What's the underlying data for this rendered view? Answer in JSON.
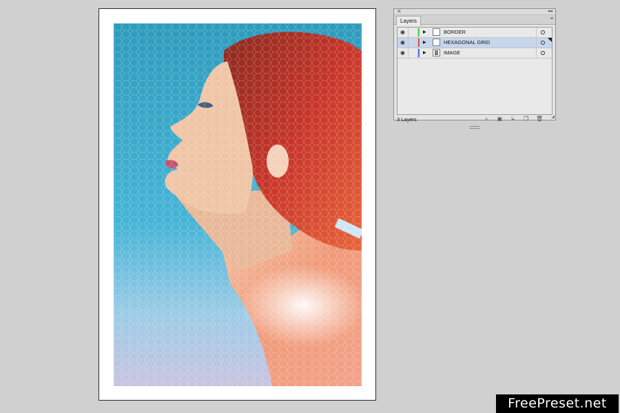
{
  "panel": {
    "close_glyph": "✕",
    "collapse_glyph": "◂◂",
    "tab_label": "Layers",
    "menu_glyph": "≡",
    "layers": [
      {
        "name": "BORDER",
        "color": "#4cd44c",
        "visible": true,
        "selected": false
      },
      {
        "name": "HEXAGONAL GRID",
        "color": "#e84a4a",
        "visible": true,
        "selected": true
      },
      {
        "name": "IMAGE",
        "color": "#4a6fe8",
        "visible": true,
        "selected": false
      }
    ],
    "footer_label": "3 Layers",
    "footer_icons": [
      "search-icon",
      "make-clipping-mask-icon",
      "create-sublayer-icon",
      "new-layer-icon",
      "trash-icon"
    ]
  },
  "watermark": {
    "text": "FreePreset.net"
  }
}
